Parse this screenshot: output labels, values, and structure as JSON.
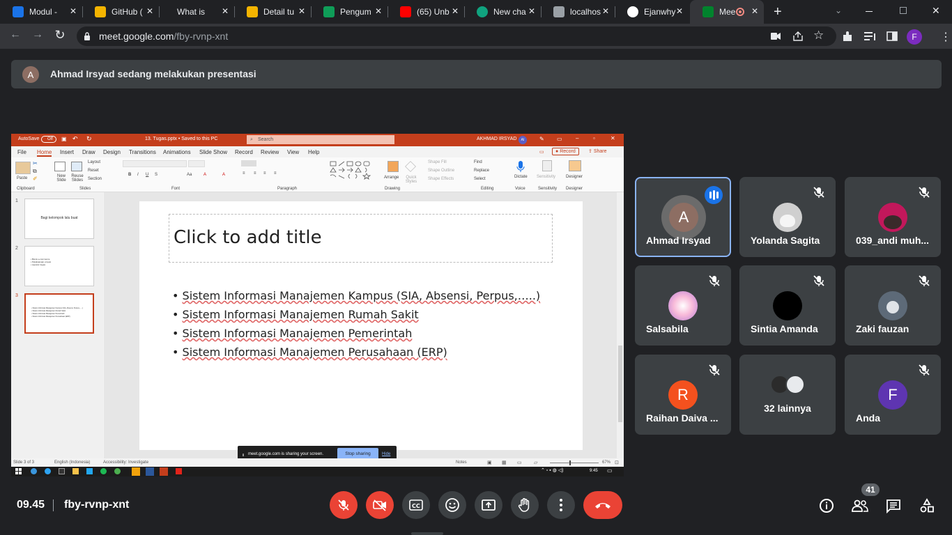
{
  "browser": {
    "tabs": [
      {
        "label": "Modul -",
        "color": "#1a73e8"
      },
      {
        "label": "GitHub (",
        "color": "#f4b400"
      },
      {
        "label": "What is",
        "color": "#202124"
      },
      {
        "label": "Detail tu",
        "color": "#0f9d58"
      },
      {
        "label": "Pengum",
        "color": "#0f9d58"
      },
      {
        "label": "(65) Unb",
        "color": "#ff0000"
      },
      {
        "label": "New cha",
        "color": "#10a37f"
      },
      {
        "label": "localhos",
        "color": "#9aa0a6"
      },
      {
        "label": "Ejanwhy",
        "color": "#ffffff"
      },
      {
        "label": "Mee",
        "color": "#00832d"
      }
    ],
    "new_tab": "+",
    "url_domain": "meet.google.com",
    "url_path": "/fby-rvnp-xnt",
    "profile_initial": "F"
  },
  "banner": {
    "avatar_initial": "A",
    "text": "Ahmad Irsyad sedang melakukan presentasi"
  },
  "presentation": {
    "autosave": "AutoSave",
    "autosave_state": "Off",
    "filename": "13. Tugas.pptx • Saved to this PC",
    "search": "Search",
    "user": "AKHMAD IRSYAD",
    "user_initials": "AI",
    "ribbon_tabs": [
      "File",
      "Home",
      "Insert",
      "Draw",
      "Design",
      "Transitions",
      "Animations",
      "Slide Show",
      "Record",
      "Review",
      "View",
      "Help"
    ],
    "record_button": "Record",
    "share_button": "Share",
    "ribbon_groups": [
      "Clipboard",
      "Slides",
      "Font",
      "Paragraph",
      "Drawing",
      "Editing",
      "Voice",
      "Sensitivity",
      "Designer"
    ],
    "ribbon_buttons": {
      "paste": "Paste",
      "new_slide": "New Slide",
      "reuse_slides": "Reuse Slides",
      "layout": "Layout",
      "reset": "Reset",
      "section": "Section",
      "arrange": "Arrange",
      "quick_styles": "Quick Styles",
      "shape_fill": "Shape Fill",
      "shape_outline": "Shape Outline",
      "shape_effects": "Shape Effects",
      "find": "Find",
      "replace": "Replace",
      "select": "Select",
      "dictate": "Dictate",
      "sensitivity": "Sensitivity",
      "designer": "Designer"
    },
    "thumbnails": [
      {
        "number": "1",
        "text": "Bagi kelompok lalu buat"
      },
      {
        "number": "2",
        "text": "• Bisnis e-commerce\n• Pelaksanaan proyek\n• Laporan tugas"
      },
      {
        "number": "3",
        "text": "• Sistem Informasi Manajemen Kampus (SIA, Absensi, Perpus,.....)\n• Sistem Informasi Manajemen Rumah Sakit\n• Sistem Informasi Manajemen Pemerintah\n• Sistem Informasi Manajemen Perusahaan (ERP)"
      }
    ],
    "slide": {
      "title_placeholder": "Click to add title",
      "bullets": [
        "Sistem Informasi Manajemen Kampus (SIA, Absensi, Perpus,…..)",
        "Sistem Informasi Manajemen Rumah Sakit",
        "Sistem Informasi Manajemen Pemerintah",
        "Sistem Informasi Manajemen Perusahaan (ERP)"
      ]
    },
    "status": {
      "slide_count": "Slide 3 of 3",
      "language": "English (Indonesia)",
      "accessibility": "Accessibility: Investigate",
      "notes": "Notes",
      "zoom": "67%"
    },
    "sharing_bar": {
      "text": "meet.google.com is sharing your screen.",
      "stop": "Stop sharing",
      "hide": "Hide"
    },
    "taskbar_time": "9:45"
  },
  "participants": [
    {
      "name": "Ahmad Irsyad",
      "initial": "A",
      "color": "#8d6e63",
      "speaking": true
    },
    {
      "name": "Yolanda Sagita",
      "initial": "",
      "color": "#cfcfcf"
    },
    {
      "name": "039_andi muh...",
      "initial": "",
      "color": "#c2185b"
    },
    {
      "name": "Salsabila",
      "initial": "",
      "color": "#e1bee7"
    },
    {
      "name": "Sintia Amanda",
      "initial": "",
      "color": "#000000"
    },
    {
      "name": "Zaki fauzan",
      "initial": "",
      "color": "#5d6a78"
    },
    {
      "name": "Raihan Daiva ...",
      "initial": "R",
      "color": "#f4511e"
    },
    {
      "name": "32 lainnya",
      "initial": "",
      "color": "#3c4043"
    },
    {
      "name": "Anda",
      "initial": "F",
      "color": "#5e35b1"
    }
  ],
  "meeting": {
    "time": "09.45",
    "code": "fby-rvnp-xnt",
    "participant_count": "41"
  },
  "icons": {
    "speaking": "audio-wave-icon",
    "muted": "mic-off-icon"
  }
}
